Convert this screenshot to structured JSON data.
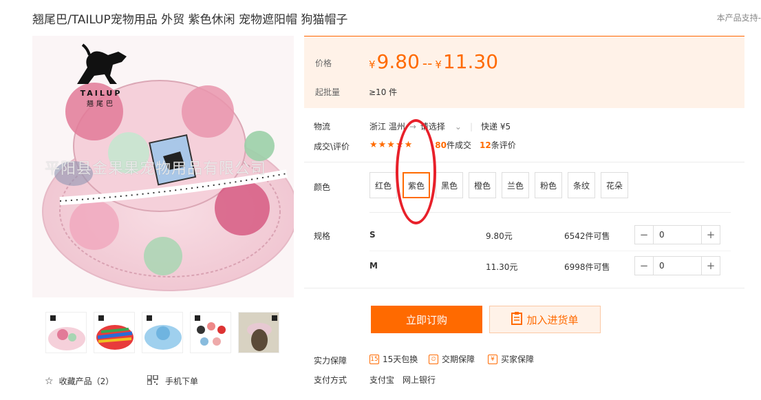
{
  "product": {
    "title": "翘尾巴/TAILUP宠物用品 外贸 紫色休闲 宠物遮阳帽 狗猫帽子",
    "support_text": "本产品支持-"
  },
  "brand": {
    "logo_text": "TAILUP",
    "logo_sub": "翘尾巴"
  },
  "image": {
    "watermark": "平阳县金果果宠物用品有限公司",
    "thumbnail_count": 5
  },
  "price": {
    "label": "价格",
    "currency": "¥",
    "low": "9.80",
    "separator": "--",
    "high": "11.30",
    "moq_label": "起批量",
    "moq_value": "≥10 件"
  },
  "logistics": {
    "label": "物流",
    "origin": "浙江 温州",
    "destination_placeholder": "请选择",
    "express": "快递 ¥5"
  },
  "deals": {
    "label": "成交\\评价",
    "stars": "★★★★★",
    "count": "80",
    "count_suffix": "件成交",
    "reviews": "12",
    "reviews_suffix": "条评价"
  },
  "color": {
    "label": "颜色",
    "options": [
      "红色",
      "紫色",
      "黑色",
      "橙色",
      "兰色",
      "粉色",
      "条纹",
      "花朵"
    ],
    "selected": "紫色"
  },
  "spec": {
    "label": "规格",
    "rows": [
      {
        "name": "S",
        "price": "9.80元",
        "stock": "6542件可售",
        "qty": "0"
      },
      {
        "name": "M",
        "price": "11.30元",
        "stock": "6998件可售",
        "qty": "0"
      }
    ]
  },
  "actions": {
    "buy_now": "立即订购",
    "add_to_list": "加入进货单"
  },
  "guarantee": {
    "label": "实力保障",
    "items": [
      "15天包换",
      "交期保障",
      "买家保障"
    ]
  },
  "payment": {
    "label": "支付方式",
    "methods": [
      "支付宝",
      "网上银行"
    ]
  },
  "footer": {
    "favorite": "收藏产品（2）",
    "mobile_order": "手机下单"
  },
  "colors": {
    "accent": "#ff6a00",
    "price_bg": "#fff2e8",
    "annotation": "#e8202a"
  }
}
